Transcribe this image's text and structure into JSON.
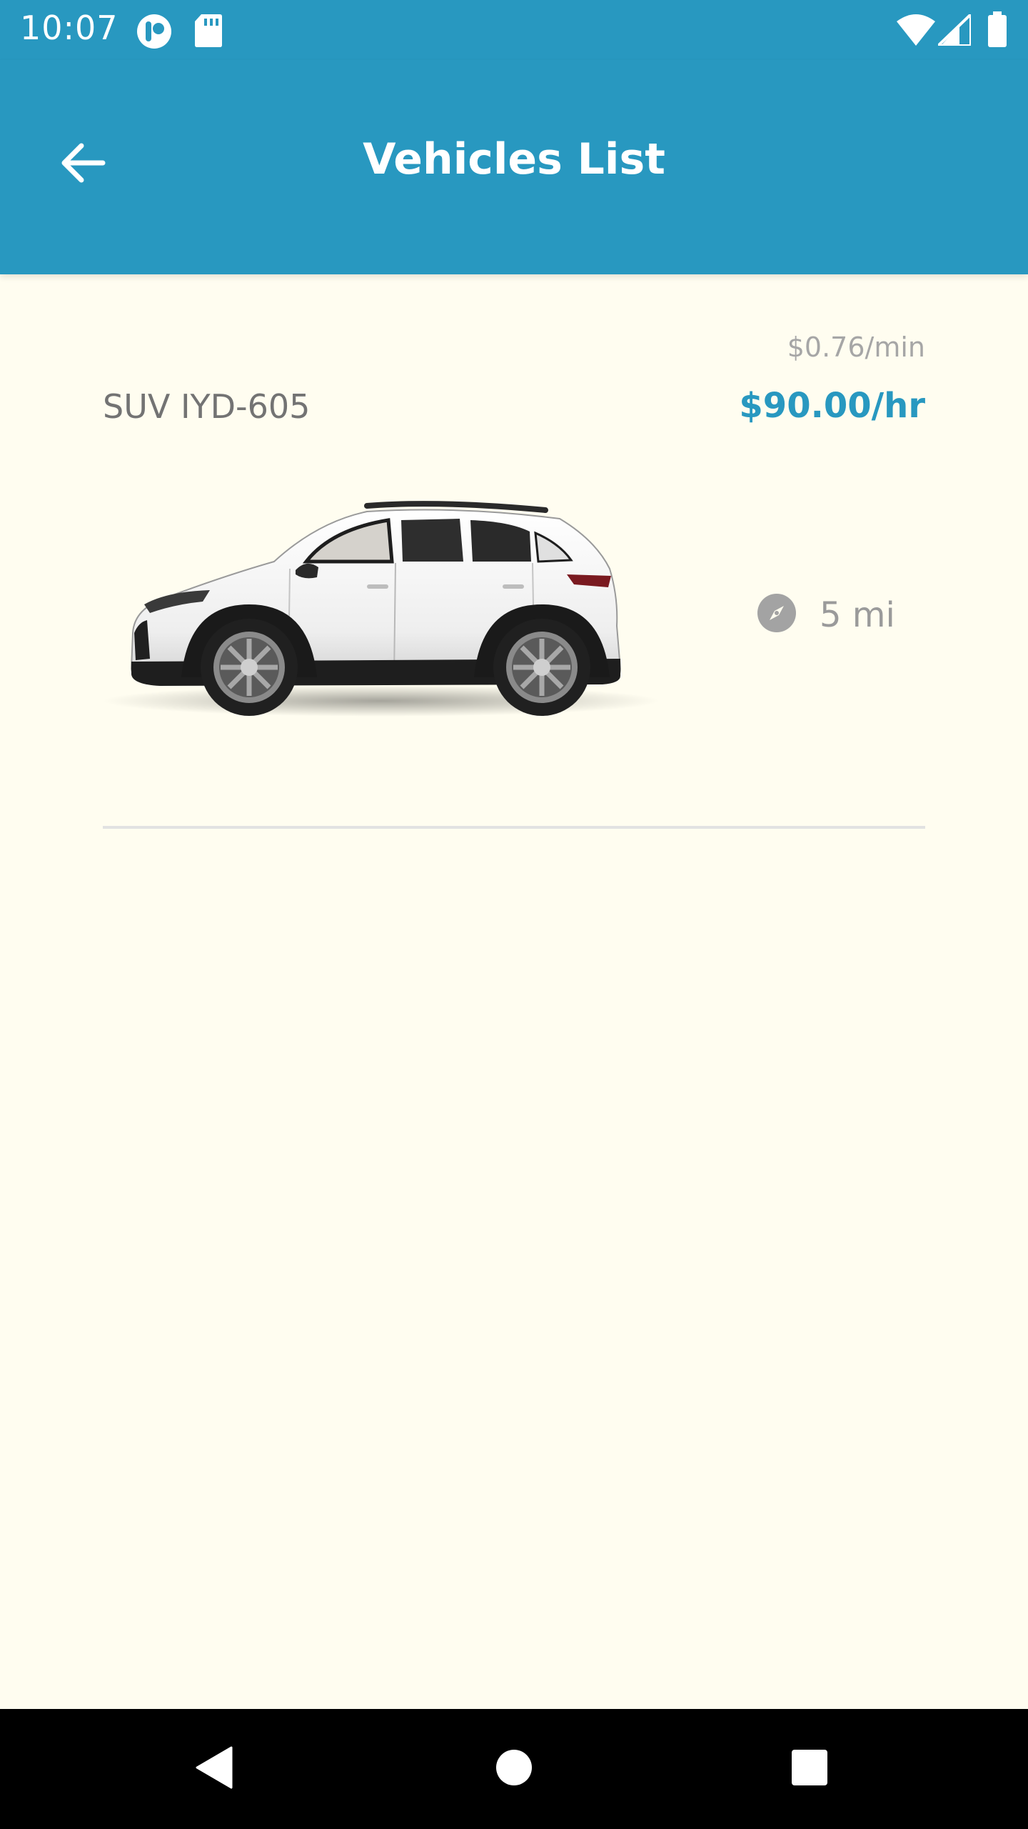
{
  "status_bar": {
    "time": "10:07",
    "left_icons": [
      "app-notification-icon",
      "sd-card-icon"
    ],
    "right_icons": [
      "wifi-icon",
      "cell-signal-icon",
      "battery-icon"
    ]
  },
  "app_bar": {
    "title": "Vehicles List",
    "back_icon": "arrow-left-icon"
  },
  "vehicles": [
    {
      "name": "SUV IYD-605",
      "price_per_min": "$0.76/min",
      "price_per_hour": "$90.00/hr",
      "distance": "5 mi",
      "distance_icon": "compass-icon",
      "image": "white-suv-side-view"
    }
  ],
  "nav_bar": {
    "buttons": [
      "back-triangle-icon",
      "home-circle-icon",
      "recents-square-icon"
    ]
  },
  "colors": {
    "primary": "#2898c0",
    "background": "#fffdf0",
    "secondary_text": "#737373"
  }
}
